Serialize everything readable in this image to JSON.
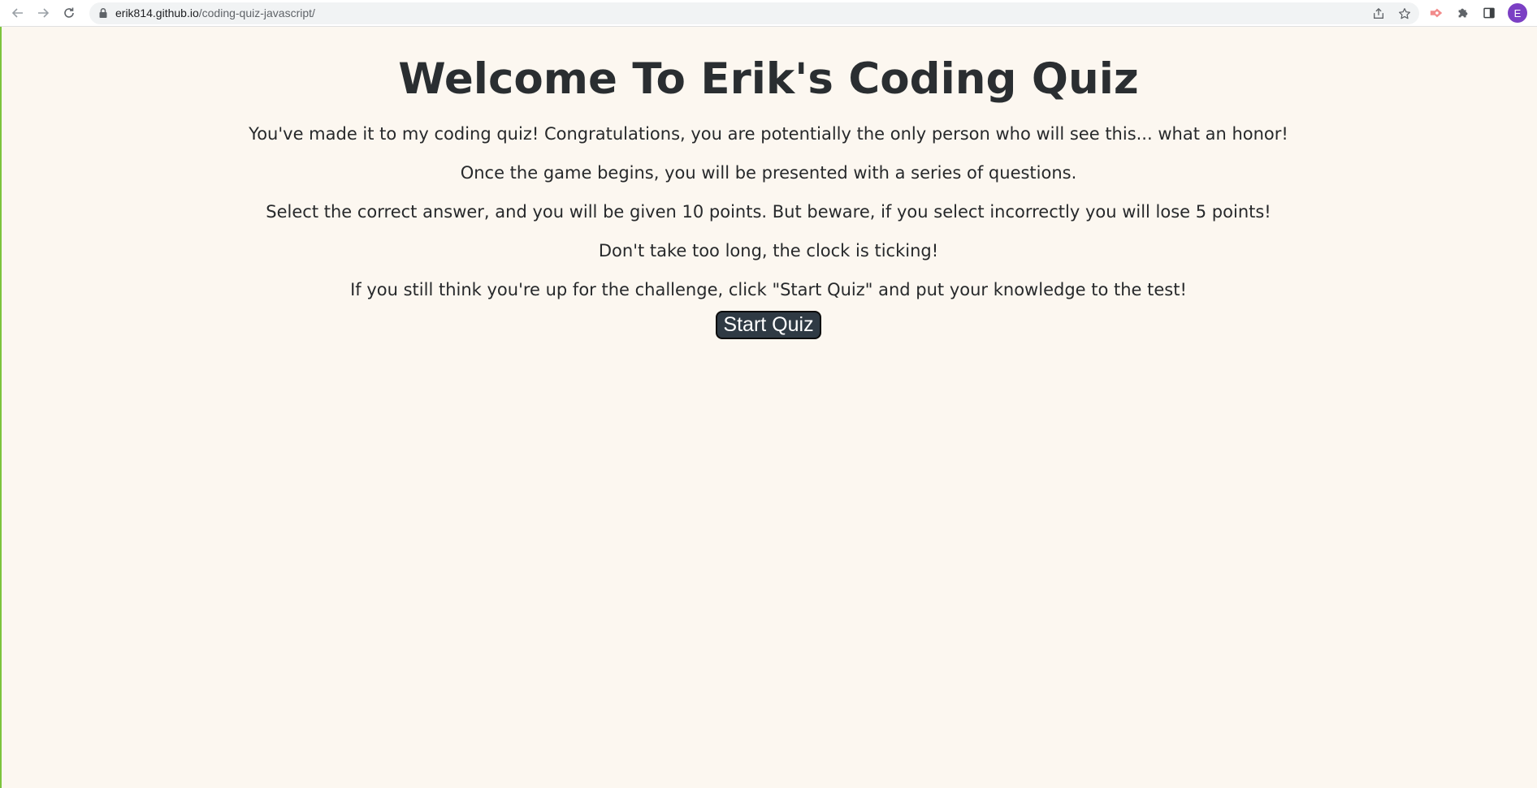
{
  "browser": {
    "url_host": "erik814.github.io",
    "url_path": "/coding-quiz-javascript/",
    "profile_initial": "E",
    "icons": [
      "back-arrow-icon",
      "forward-arrow-icon",
      "reload-icon",
      "lock-icon",
      "share-icon",
      "star-icon",
      "extension-red-icon",
      "puzzle-extensions-icon",
      "side-panel-icon"
    ]
  },
  "page": {
    "title": "Welcome To Erik's Coding Quiz",
    "paragraphs": [
      "You've made it to my coding quiz! Congratulations, you are potentially the only person who will see this... what an honor!",
      "Once the game begins, you will be presented with a series of questions.",
      "Select the correct answer, and you will be given 10 points. But beware, if you select incorrectly you will lose 5 points!",
      "Don't take too long, the clock is ticking!",
      "If you still think you're up for the challenge, click \"Start Quiz\" and put your knowledge to the test!"
    ],
    "start_button_label": "Start Quiz"
  },
  "colors": {
    "background": "#fcf7f0",
    "text": "#27292b",
    "button_bg": "#2f3a44",
    "button_text": "#ffffff",
    "avatar": "#7b3fc4",
    "left_edge": "#7cc43c"
  }
}
